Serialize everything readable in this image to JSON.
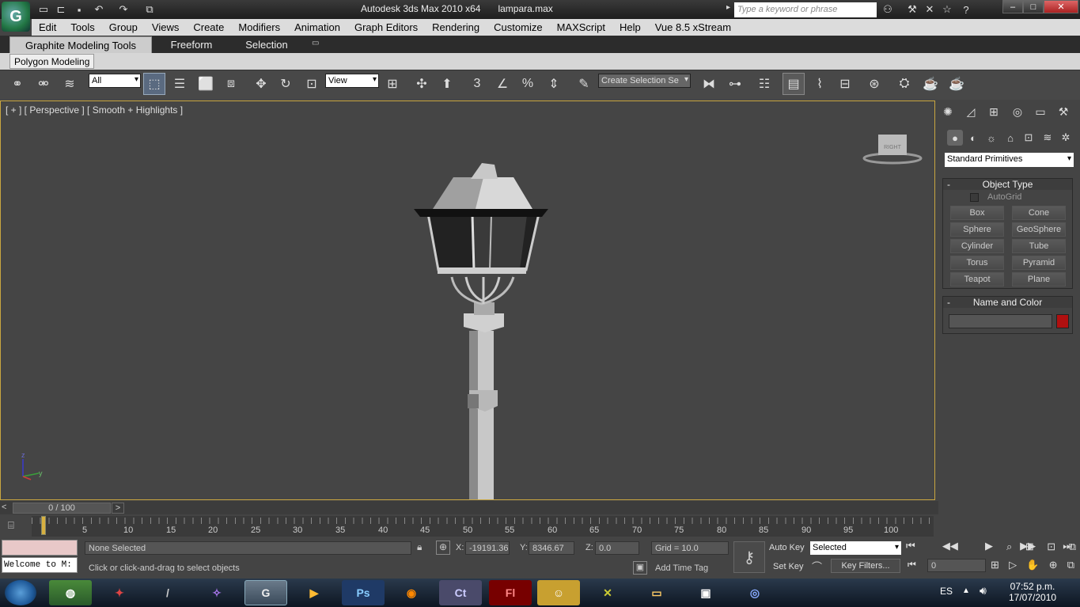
{
  "app": {
    "title": "Autodesk 3ds Max  2010 x64",
    "file": "lampara.max",
    "search_placeholder": "Type a keyword or phrase"
  },
  "menu": [
    "Edit",
    "Tools",
    "Group",
    "Views",
    "Create",
    "Modifiers",
    "Animation",
    "Graph Editors",
    "Rendering",
    "Customize",
    "MAXScript",
    "Help",
    "Vue 8.5 xStream"
  ],
  "ribbon": {
    "tabs": [
      "Graphite Modeling Tools",
      "Freeform",
      "Selection"
    ],
    "panel_tab": "Polygon Modeling"
  },
  "toolbar": {
    "filter": "All",
    "coord": "View",
    "snap_num": "3",
    "selection_set": "Create Selection Se"
  },
  "viewport": {
    "label": "[ + ] [ Perspective ] [ Smooth + Highlights ]",
    "viewcube": "RIGHT"
  },
  "command_panel": {
    "category": "Standard Primitives",
    "object_type_title": "Object Type",
    "autogrid": "AutoGrid",
    "buttons": [
      "Box",
      "Cone",
      "Sphere",
      "GeoSphere",
      "Cylinder",
      "Tube",
      "Torus",
      "Pyramid",
      "Teapot",
      "Plane"
    ],
    "name_color_title": "Name and Color",
    "swatch_color": "#b01010"
  },
  "timeline": {
    "position": "0 / 100",
    "ticks": [
      "5",
      "10",
      "15",
      "20",
      "25",
      "30",
      "35",
      "40",
      "45",
      "50",
      "55",
      "60",
      "65",
      "70",
      "75",
      "80",
      "85",
      "90",
      "95",
      "100"
    ]
  },
  "status": {
    "selection": "None Selected",
    "prompt": "Click or click-and-drag to select objects",
    "script_listener": "Welcome to M:",
    "x_label": "X:",
    "x": "-19191.36",
    "y_label": "Y:",
    "y": "8346.67",
    "z_label": "Z:",
    "z": "0.0",
    "grid": "Grid = 10.0",
    "add_time_tag": "Add Time Tag",
    "auto_key": "Auto Key",
    "set_key": "Set Key",
    "key_mode": "Selected",
    "key_filters": "Key Filters...",
    "frame": "0"
  },
  "taskbar": {
    "lang": "ES",
    "time": "07:52 p.m.",
    "date": "17/07/2010",
    "apps": [
      "Ps",
      "Ct",
      "Fl"
    ]
  }
}
